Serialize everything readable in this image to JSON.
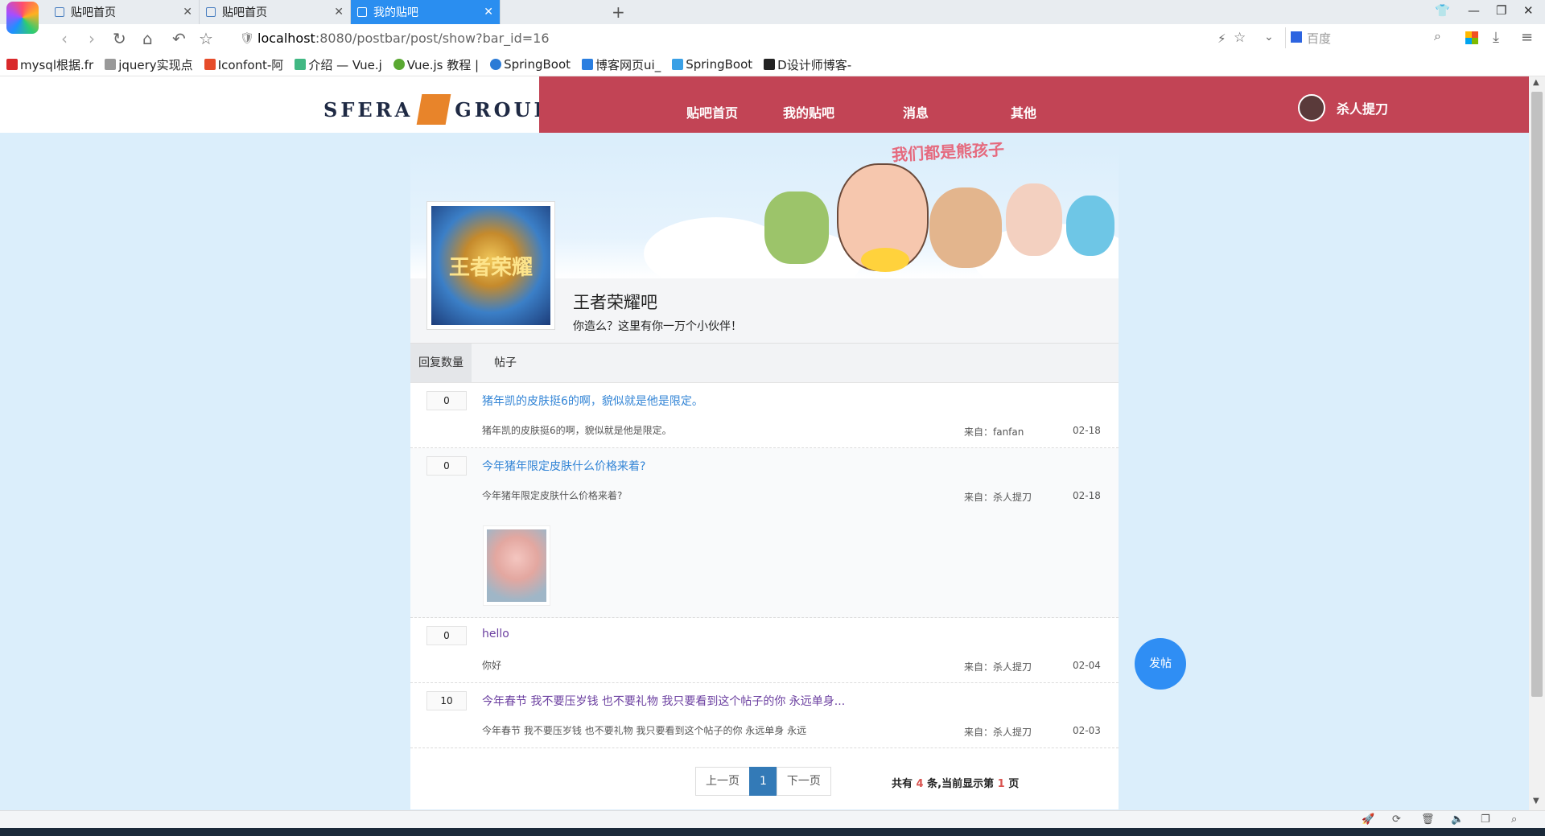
{
  "browser": {
    "tabs": [
      {
        "title": "贴吧首页"
      },
      {
        "title": "贴吧首页"
      },
      {
        "title": "我的贴吧"
      }
    ],
    "new_tab": "+",
    "url_host": "localhost",
    "url_path": ":8080/postbar/post/show?bar_id=16",
    "search_engine": "百度",
    "bookmarks": [
      {
        "label": "mysql根据.fr",
        "color": "#d9292b"
      },
      {
        "label": "jquery实现点",
        "color": "#999999"
      },
      {
        "label": "Iconfont-阿",
        "color": "#e64c2a"
      },
      {
        "label": "介绍 — Vue.j",
        "color": "#41b883"
      },
      {
        "label": "Vue.js 教程 |",
        "color": "#5aa832"
      },
      {
        "label": "SpringBoot",
        "color": "#2b7bd6"
      },
      {
        "label": "博客网页ui_",
        "color": "#2a7ee0"
      },
      {
        "label": "SpringBoot",
        "color": "#3aa0e6"
      },
      {
        "label": "D设计师博客-",
        "color": "#222222"
      }
    ]
  },
  "site": {
    "logo_left": "SFERA",
    "logo_right": "GROUP",
    "nav": [
      "贴吧首页",
      "我的贴吧",
      "消息",
      "其他"
    ],
    "username": "杀人提刀",
    "slogan": "我们都是熊孩子",
    "brand_color": "#c24455"
  },
  "bar": {
    "avatar_text": "王者荣耀",
    "name": "王者荣耀吧",
    "desc": "你造么？这里有你一万个小伙伴！"
  },
  "post_tabs": [
    "回复数量",
    "帖子"
  ],
  "posts": [
    {
      "replies": "0",
      "title": "猪年凯的皮肤挺6的啊，貌似就是他是限定。",
      "excerpt": "猪年凯的皮肤挺6的啊，貌似就是他是限定。",
      "from": "来自：fanfan",
      "date": "02-18"
    },
    {
      "replies": "0",
      "title": "今年猪年限定皮肤什么价格来着?",
      "excerpt": "今年猪年限定皮肤什么价格来着?",
      "from": "来自：杀人提刀",
      "date": "02-18"
    },
    {
      "replies": "0",
      "title": "hello",
      "excerpt": "你好",
      "from": "来自：杀人提刀",
      "date": "02-04"
    },
    {
      "replies": "10",
      "title": "今年春节 我不要压岁钱 也不要礼物 我只要看到这个帖子的你 永远单身...",
      "excerpt": "今年春节 我不要压岁钱 也不要礼物 我只要看到这个帖子的你 永远单身 永远",
      "from": "来自：杀人提刀",
      "date": "02-03"
    }
  ],
  "pager": {
    "prev": "上一页",
    "current": "1",
    "next": "下一页",
    "info_a": "共有",
    "total": "4",
    "info_b": "条,当前显示第",
    "page": "1",
    "info_c": "页"
  },
  "post_button": "发帖"
}
